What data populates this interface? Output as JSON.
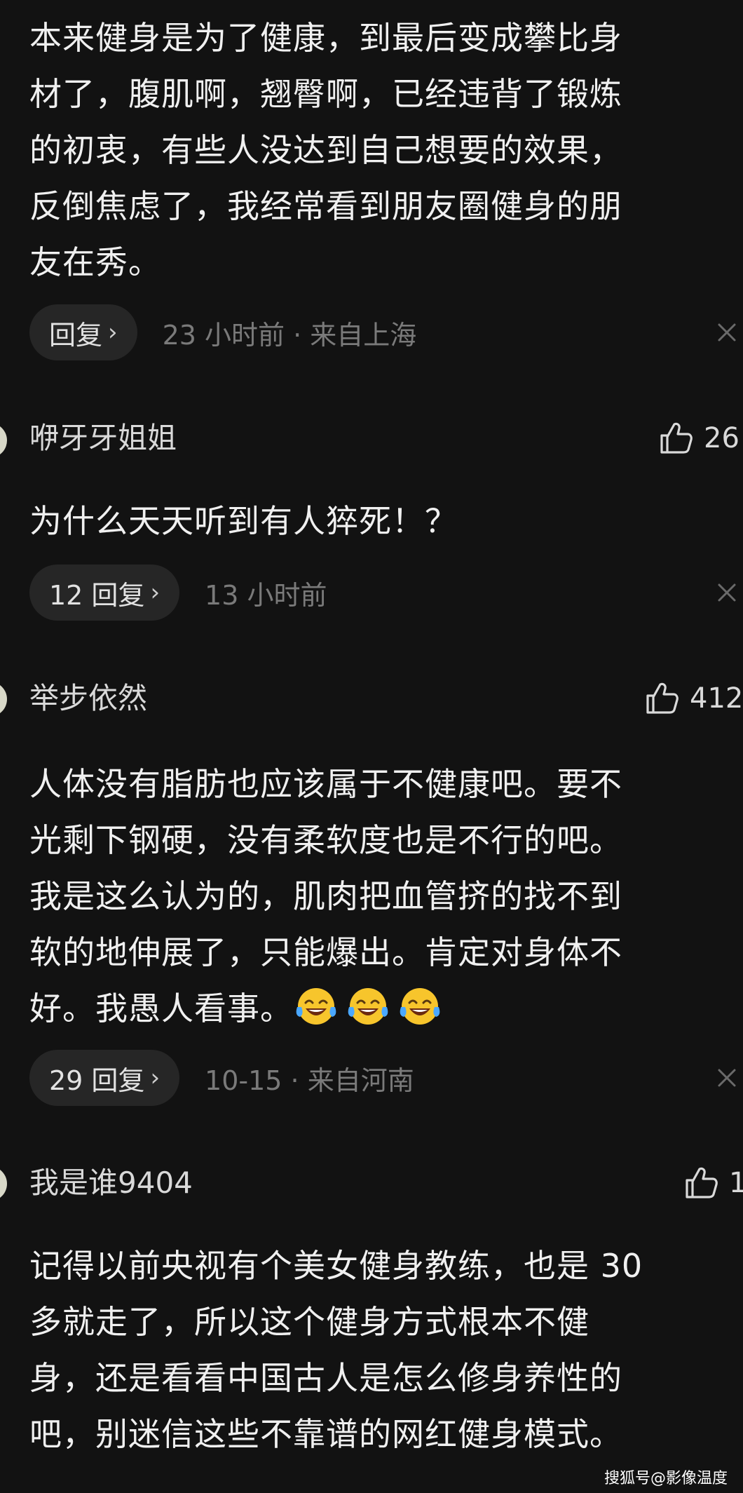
{
  "comments": [
    {
      "text_lines": [
        "本来健身是为了健康，到最后变成攀比身",
        "材了，腹肌啊，翘臀啊，已经违背了锻炼",
        "的初衷，有些人没达到自己想要的效果，",
        "反倒焦虑了，我经常看到朋友圈健身的朋",
        "友在秀。"
      ],
      "reply_label": "回复",
      "meta": "23 小时前 · 来自上海"
    },
    {
      "username": "咿牙牙姐姐",
      "likes": "26",
      "text_lines": [
        "为什么天天听到有人猝死！？"
      ],
      "reply_label": "12 回复",
      "meta": "13 小时前"
    },
    {
      "username": "举步依然",
      "likes": "412",
      "text_lines": [
        "人体没有脂肪也应该属于不健康吧。要不",
        "光剩下钢硬，没有柔软度也是不行的吧。",
        "我是这么认为的，肌肉把血管挤的找不到",
        "软的地伸展了，只能爆出。肯定对身体不",
        "好。我愚人看事。"
      ],
      "emojis": [
        "laughing-tears-emoji",
        "laughing-tears-emoji",
        "laughing-tears-emoji"
      ],
      "reply_label": "29 回复",
      "meta": "10-15 · 来自河南"
    },
    {
      "username": "我是谁9404",
      "likes": "1",
      "text_lines": [
        "记得以前央视有个美女健身教练，也是 30",
        "多就走了，所以这个健身方式根本不健",
        "身，还是看看中国古人是怎么修身养性的",
        "吧，别迷信这些不靠谱的网红健身模式。"
      ]
    }
  ],
  "icons": {
    "like": "thumbs-up-icon",
    "dismiss": "close-icon",
    "chevron": "chevron-right-icon"
  },
  "chevron_glyph": "›",
  "watermark": "搜狐号@影像温度"
}
